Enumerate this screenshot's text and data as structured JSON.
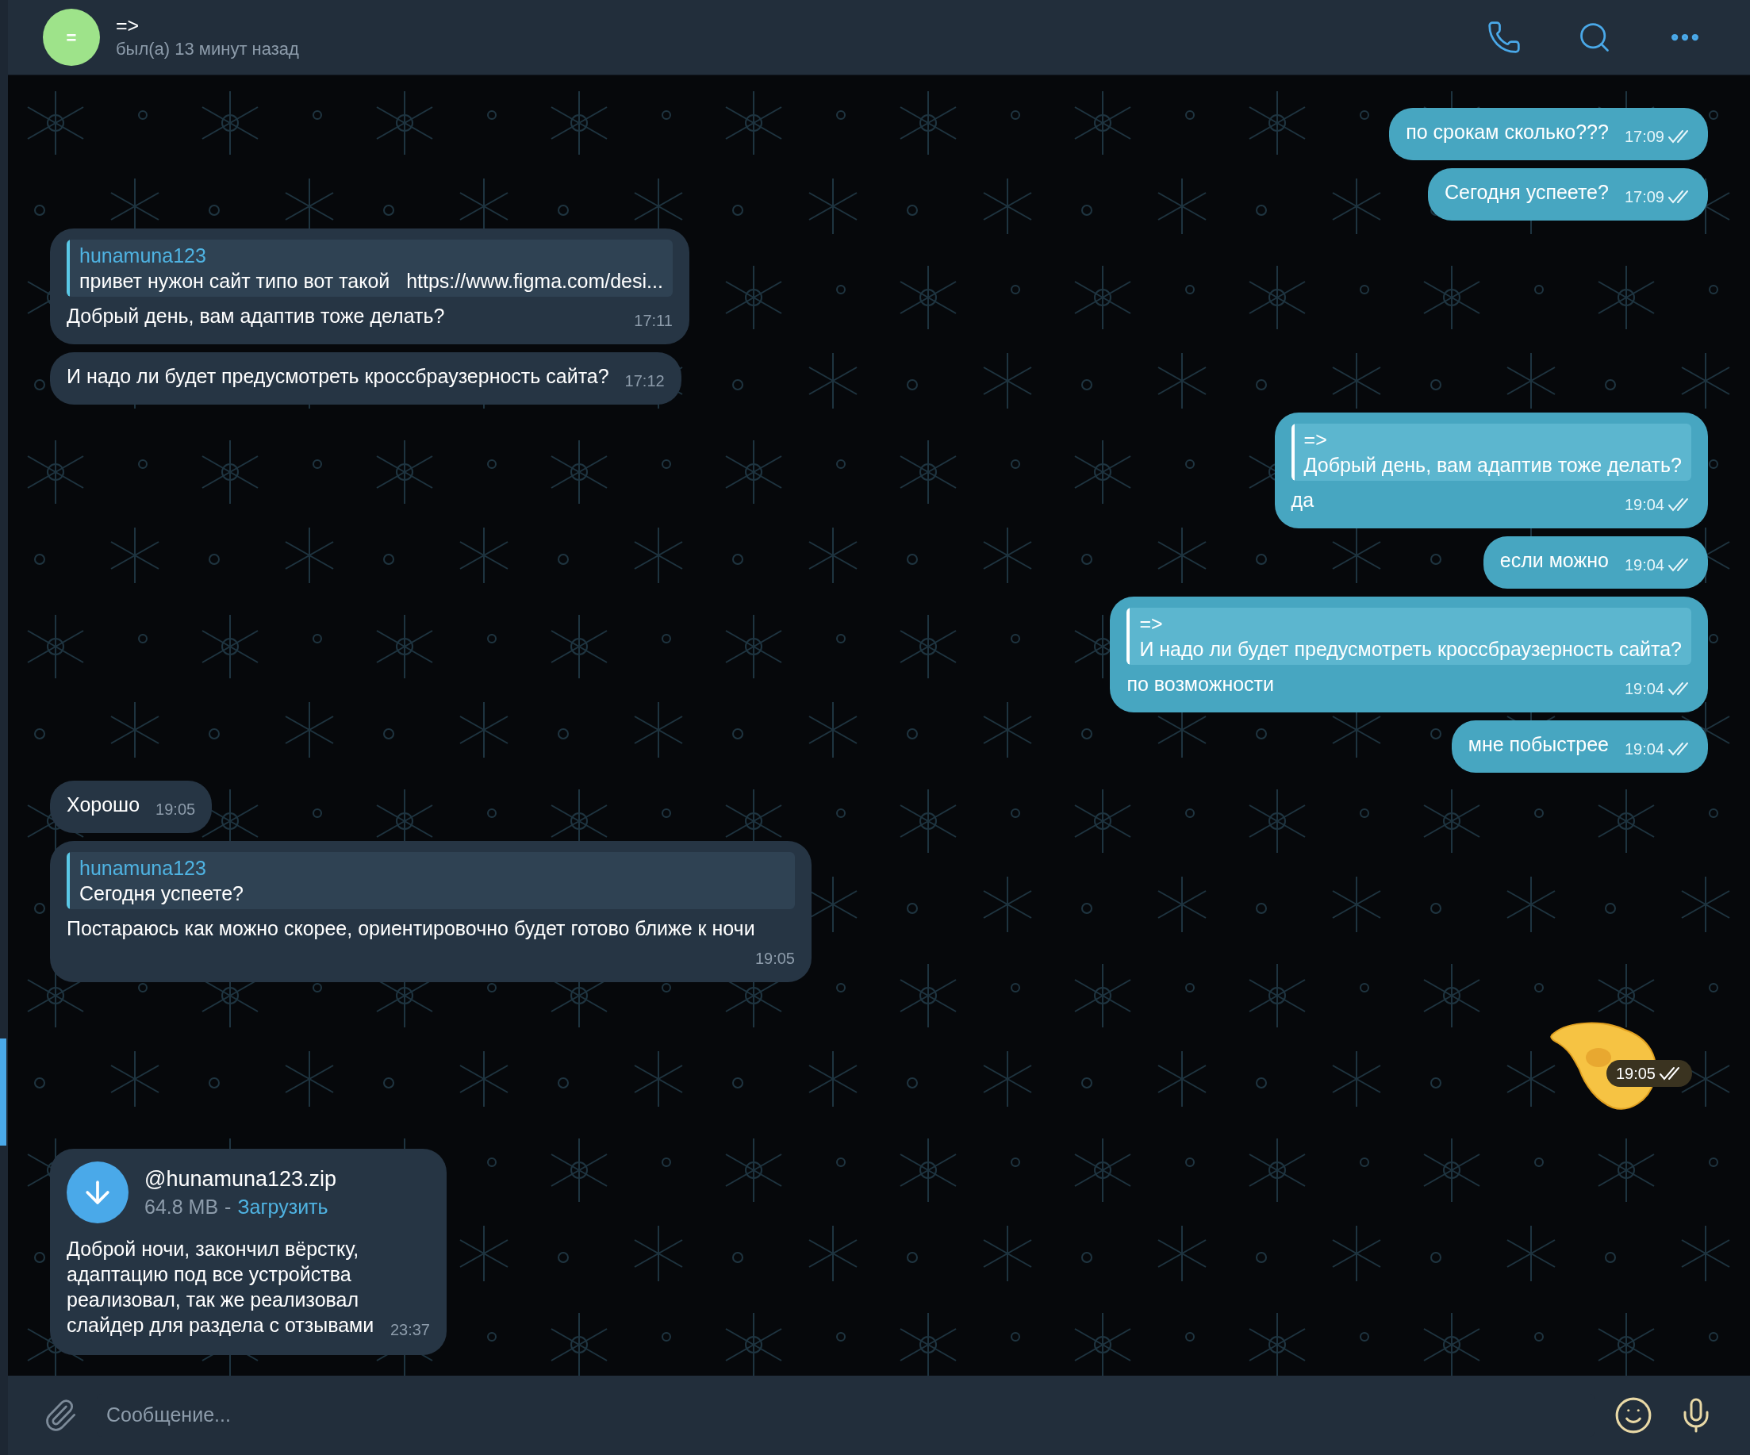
{
  "header": {
    "avatar_letter": "=",
    "title": "=>",
    "status": "был(а) 13 минут назад"
  },
  "messages": [
    {
      "kind": "text",
      "outgoing": true,
      "text": "по срокам сколько???",
      "time": "17:09",
      "read": true
    },
    {
      "kind": "text",
      "outgoing": true,
      "text": "Сегодня успеете?",
      "time": "17:09",
      "read": true
    },
    {
      "kind": "text",
      "outgoing": false,
      "reply": {
        "author": "hunamuna123",
        "text": "привет нужон сайт типо вот такой   https://www.figma.com/desi..."
      },
      "text": "Добрый день, вам адаптив тоже делать?",
      "time": "17:11"
    },
    {
      "kind": "text",
      "outgoing": false,
      "text": "И надо ли будет предусмотреть кроссбраузерность сайта?",
      "time": "17:12"
    },
    {
      "kind": "text",
      "outgoing": true,
      "reply": {
        "author": "=>",
        "text": "Добрый день, вам адаптив тоже делать?"
      },
      "text": "да",
      "time": "19:04",
      "read": true
    },
    {
      "kind": "text",
      "outgoing": true,
      "text": "если можно",
      "time": "19:04",
      "read": true
    },
    {
      "kind": "text",
      "outgoing": true,
      "reply": {
        "author": "=>",
        "text": "И надо ли будет предусмотреть кроссбраузерность сайта?"
      },
      "text": "по возможности",
      "time": "19:04",
      "read": true
    },
    {
      "kind": "text",
      "outgoing": true,
      "text": "мне побыстрее",
      "time": "19:04",
      "read": true
    },
    {
      "kind": "text",
      "outgoing": false,
      "text": "Хорошо",
      "time": "19:05"
    },
    {
      "kind": "text",
      "outgoing": false,
      "reply": {
        "author": "hunamuna123",
        "text": "Сегодня успеете?"
      },
      "text": "Постараюсь как можно скорее, ориентировочно будет готово ближе к ночи",
      "time": "19:05"
    },
    {
      "kind": "sticker",
      "outgoing": true,
      "time": "19:05",
      "read": true
    },
    {
      "kind": "file",
      "outgoing": false,
      "file_name": "@hunamuna123.zip",
      "size": "64.8 MB",
      "separator": "-",
      "action": "Загрузить",
      "text": "Доброй ночи, закончил вёрстку, адаптацию под все устройства реализовал, так же реализовал слайдер для раздела с отзывами",
      "time": "23:37"
    }
  ],
  "composer": {
    "placeholder": "Сообщение..."
  }
}
